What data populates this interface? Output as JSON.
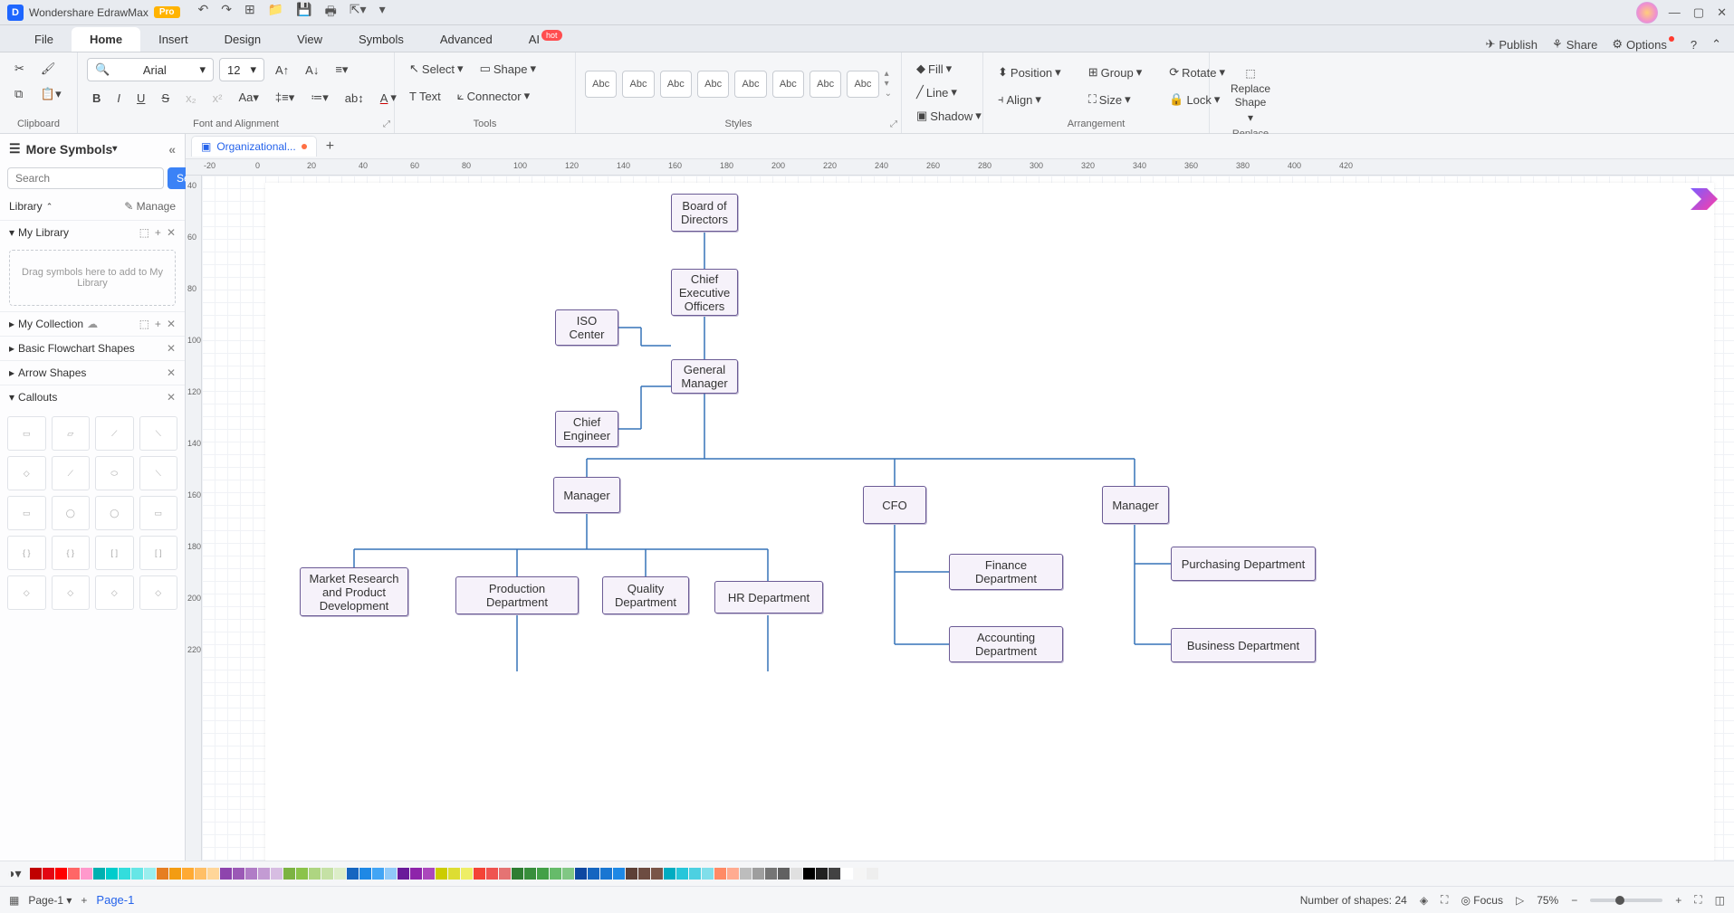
{
  "app": {
    "name": "Wondershare EdrawMax",
    "badge": "Pro"
  },
  "menu": {
    "tabs": [
      "File",
      "Home",
      "Insert",
      "Design",
      "View",
      "Symbols",
      "Advanced",
      "AI"
    ],
    "active": 1,
    "ai_hot": "hot",
    "right": {
      "publish": "Publish",
      "share": "Share",
      "options": "Options"
    }
  },
  "ribbon": {
    "font_name": "Arial",
    "font_size": "12",
    "select": "Select",
    "shape": "Shape",
    "text": "Text",
    "connector": "Connector",
    "style_label": "Abc",
    "fill": "Fill",
    "line": "Line",
    "shadow": "Shadow",
    "position": "Position",
    "align": "Align",
    "group": "Group",
    "size": "Size",
    "rotate": "Rotate",
    "lock": "Lock",
    "replace_shape": "Replace Shape",
    "groups": {
      "clipboard": "Clipboard",
      "font": "Font and Alignment",
      "tools": "Tools",
      "styles": "Styles",
      "arrangement": "Arrangement",
      "replace": "Replace"
    }
  },
  "left": {
    "more_symbols": "More Symbols",
    "search_placeholder": "Search",
    "search_btn": "Search",
    "library": "Library",
    "manage": "Manage",
    "mylib": "My Library",
    "drop_text": "Drag symbols here to add to My Library",
    "collection": "My Collection",
    "basic": "Basic Flowchart Shapes",
    "arrow": "Arrow Shapes",
    "callouts": "Callouts"
  },
  "doc": {
    "tab_name": "Organizational..."
  },
  "ruler_h": [
    -20,
    0,
    20,
    40,
    60,
    80,
    100,
    120,
    140,
    160,
    180,
    200,
    220,
    240,
    260,
    280,
    300,
    320,
    340,
    360,
    380,
    400,
    420
  ],
  "ruler_v": [
    40,
    60,
    80,
    100,
    120,
    140,
    160,
    180,
    200,
    220
  ],
  "org": {
    "board": "Board of Directors",
    "ceo": "Chief Executive Officers",
    "iso": "ISO Center",
    "gm": "General Manager",
    "chief_eng": "Chief Engineer",
    "mgr1": "Manager",
    "cfo": "CFO",
    "mgr2": "Manager",
    "market": "Market Research and Product Development",
    "prod": "Production Department",
    "quality": "Quality Department",
    "hr": "HR Department",
    "finance": "Finance Department",
    "acct": "Accounting Department",
    "purch": "Purchasing Department",
    "biz": "Business Department"
  },
  "colors": [
    "#c00000",
    "#e30613",
    "#ff0000",
    "#ff6666",
    "#ff99cc",
    "#00b0b0",
    "#00cccc",
    "#33dddd",
    "#66e6e6",
    "#99eeee",
    "#e67e22",
    "#f39c12",
    "#ffaa33",
    "#ffbf66",
    "#ffd699",
    "#8e44ad",
    "#9b59b6",
    "#b07cc6",
    "#c39bd3",
    "#d7bde2",
    "#7cb342",
    "#8bc34a",
    "#aed581",
    "#c5e1a5",
    "#dcedc8",
    "#1565c0",
    "#1e88e5",
    "#42a5f5",
    "#90caf9",
    "#6a1b9a",
    "#8e24aa",
    "#ab47bc",
    "#cccc00",
    "#dddd33",
    "#eeee66",
    "#f44336",
    "#ef5350",
    "#e57373",
    "#2e7d32",
    "#388e3c",
    "#43a047",
    "#66bb6a",
    "#81c784",
    "#0d47a1",
    "#1565c0",
    "#1976d2",
    "#1e88e5",
    "#5d4037",
    "#6d4c41",
    "#795548",
    "#00acc1",
    "#26c6da",
    "#4dd0e1",
    "#80deea",
    "#ff8a65",
    "#ffab91",
    "#bdbdbd",
    "#9e9e9e",
    "#757575",
    "#616161",
    "#e0e0e0",
    "#000000",
    "#212121",
    "#424242",
    "#ffffff",
    "#f5f5f5",
    "#eeeeee"
  ],
  "status": {
    "page_sel": "Page-1",
    "page_link": "Page-1",
    "shapes": "Number of shapes: 24",
    "focus": "Focus",
    "zoom": "75%"
  }
}
